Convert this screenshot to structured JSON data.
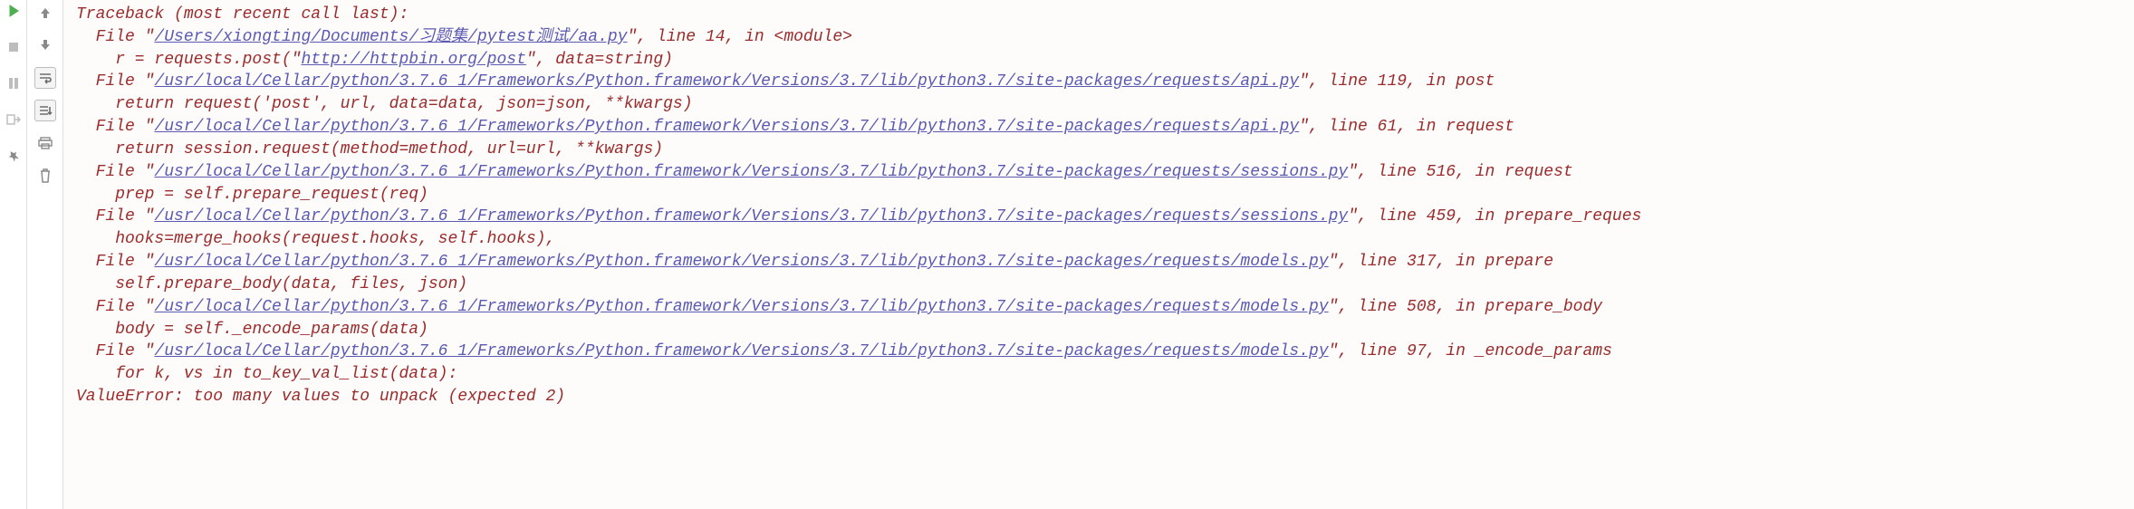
{
  "traceback": {
    "header": "Traceback (most recent call last):",
    "frames": [
      {
        "prefix": "  File \"",
        "path": "/Users/xiongting/Documents/习题集/pytest测试/aa.py",
        "suffix": "\", line 14, in <module>",
        "code_pre": "    r = requests.post(\"",
        "code_link": "http://httpbin.org/post",
        "code_post": "\", data=string)"
      },
      {
        "prefix": "  File \"",
        "path": "/usr/local/Cellar/python/3.7.6_1/Frameworks/Python.framework/Versions/3.7/lib/python3.7/site-packages/requests/api.py",
        "suffix": "\", line 119, in post",
        "code": "    return request('post', url, data=data, json=json, **kwargs)"
      },
      {
        "prefix": "  File \"",
        "path": "/usr/local/Cellar/python/3.7.6_1/Frameworks/Python.framework/Versions/3.7/lib/python3.7/site-packages/requests/api.py",
        "suffix": "\", line 61, in request",
        "code": "    return session.request(method=method, url=url, **kwargs)"
      },
      {
        "prefix": "  File \"",
        "path": "/usr/local/Cellar/python/3.7.6_1/Frameworks/Python.framework/Versions/3.7/lib/python3.7/site-packages/requests/sessions.py",
        "suffix": "\", line 516, in request",
        "code": "    prep = self.prepare_request(req)"
      },
      {
        "prefix": "  File \"",
        "path": "/usr/local/Cellar/python/3.7.6_1/Frameworks/Python.framework/Versions/3.7/lib/python3.7/site-packages/requests/sessions.py",
        "suffix": "\", line 459, in prepare_reques",
        "code": "    hooks=merge_hooks(request.hooks, self.hooks),"
      },
      {
        "prefix": "  File \"",
        "path": "/usr/local/Cellar/python/3.7.6_1/Frameworks/Python.framework/Versions/3.7/lib/python3.7/site-packages/requests/models.py",
        "suffix": "\", line 317, in prepare",
        "code": "    self.prepare_body(data, files, json)"
      },
      {
        "prefix": "  File \"",
        "path": "/usr/local/Cellar/python/3.7.6_1/Frameworks/Python.framework/Versions/3.7/lib/python3.7/site-packages/requests/models.py",
        "suffix": "\", line 508, in prepare_body",
        "code": "    body = self._encode_params(data)"
      },
      {
        "prefix": "  File \"",
        "path": "/usr/local/Cellar/python/3.7.6_1/Frameworks/Python.framework/Versions/3.7/lib/python3.7/site-packages/requests/models.py",
        "suffix": "\", line 97, in _encode_params",
        "code": "    for k, vs in to_key_val_list(data):"
      }
    ],
    "error": "ValueError: too many values to unpack (expected 2)"
  }
}
